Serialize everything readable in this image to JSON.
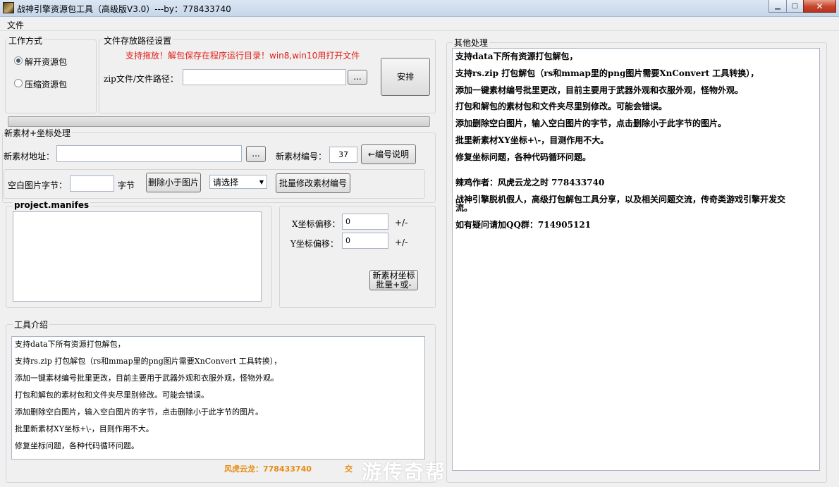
{
  "window": {
    "title": "战神引擎资源包工具（高级版V3.0）---by：778433740"
  },
  "menu": {
    "file_label": "文件"
  },
  "work_mode": {
    "title": "工作方式",
    "options": [
      {
        "label": "解开资源包",
        "checked": true
      },
      {
        "label": "压缩资源包",
        "checked": false
      }
    ]
  },
  "file_path": {
    "title": "文件存放路径设置",
    "notice": "支持拖放！解包保存在程序运行目录！win8,win10用打开文件",
    "zip_label": "zip文件/文件路径：",
    "zip_value": "",
    "browse_label": "...",
    "arrange_label": "安排"
  },
  "new_material": {
    "title": "新素材+坐标处理",
    "address_label": "新素材地址：",
    "address_value": "",
    "browse_label": "...",
    "number_label": "新素材编号：",
    "number_value": "37",
    "number_help_label": "←编号说明",
    "blank_bytes_label": "空白图片字节：",
    "blank_bytes_value": "",
    "bytes_unit": "字节",
    "delete_small_label": "删除小于图片",
    "select_placeholder": "请选择",
    "batch_modify_label": "批量修改素材编号"
  },
  "manifest": {
    "title": "project.manifes",
    "content": ""
  },
  "offset": {
    "x_label": "X坐标偏移：",
    "x_value": "0",
    "x_suffix": "+/-",
    "y_label": "Y坐标偏移：",
    "y_value": "0",
    "y_suffix": "+/-",
    "batch_label_1": "新素材坐标",
    "batch_label_2": "批量+或-"
  },
  "intro": {
    "title": "工具介绍",
    "lines": [
      "支持data下所有资源打包解包，",
      "支持rs.zip 打包解包（rs和mmap里的png图片需要XnConvert 工具转换），",
      "添加一键素材编号批里更改，目前主要用于武器外观和衣服外观，怪物外观。",
      "打包和解包的素材包和文件夹尽里别修改。可能会错误。",
      "添加删除空白图片，输入空白图片的字节，点击删除小于此字节的图片。",
      "批里新素材XY坐标+\\-，目则作用不大。",
      "修复坐标问题，各种代码循环问题。"
    ]
  },
  "footer": {
    "left": "风虎云龙：778433740",
    "right": "交",
    "watermark": "游传奇帮"
  },
  "other": {
    "title": "其他处理",
    "lines": [
      "支持data下所有资源打包解包，",
      "支持rs.zip 打包解包（rs和mmap里的png图片需要XnConvert 工具转换），",
      "添加一键素材编号批里更改，目前主要用于武器外观和衣服外观，怪物外观。",
      "打包和解包的素材包和文件夹尽里别修改。可能会错误。",
      "添加删除空白图片，输入空白图片的字节，点击删除小于此字节的图片。",
      "批里新素材XY坐标+\\-，目测作用不大。",
      "修复坐标问题，各种代码循环问题。",
      "",
      "辣鸡作者：风虎云龙之时     778433740",
      "战神引擎脱机假人，高级打包解包工具分享，以及相关问题交流，传奇类游戏引擎开发交",
      "流。",
      "如有疑问请加QQ群：714905121"
    ]
  },
  "colors": {
    "notice_red": "#e0201a",
    "footer_orange": "#e88a10"
  }
}
